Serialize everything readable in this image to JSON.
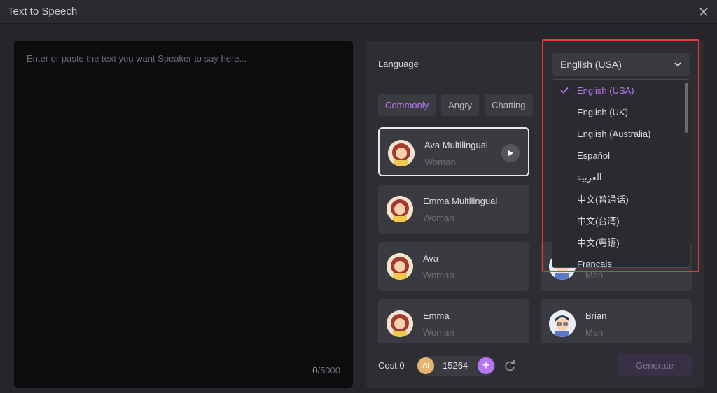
{
  "window": {
    "title": "Text to Speech"
  },
  "editor": {
    "placeholder": "Enter or paste the text you want Speaker to say here...",
    "count": "0",
    "limit": "/5000"
  },
  "language": {
    "label": "Language",
    "selected": "English (USA)",
    "options": [
      "English (USA)",
      "English (UK)",
      "English (Australia)",
      "Español",
      "العربية",
      "中文(普通话)",
      "中文(台湾)",
      "中文(粤语)",
      "Français"
    ]
  },
  "tabs": [
    "Commonly",
    "Angry",
    "Chatting"
  ],
  "voices": [
    {
      "name": "Ava Multilingual",
      "gender": "Woman"
    },
    {
      "name": "Emma Multilingual",
      "gender": "Woman"
    },
    {
      "name": "Ava",
      "gender": "Woman"
    },
    {
      "name": "Emma",
      "gender": "Woman"
    },
    {
      "name": "",
      "gender": "Man"
    },
    {
      "name": "Brian",
      "gender": "Man"
    }
  ],
  "footer": {
    "cost_label": "Cost:0",
    "coin_icon": "AI",
    "coins": "15264",
    "add_symbol": "+",
    "generate_label": "Generate"
  },
  "colors": {
    "accent": "#b777f3",
    "highlight": "#e33b3b",
    "background": "#25252a",
    "panel": "#2d2d33"
  }
}
